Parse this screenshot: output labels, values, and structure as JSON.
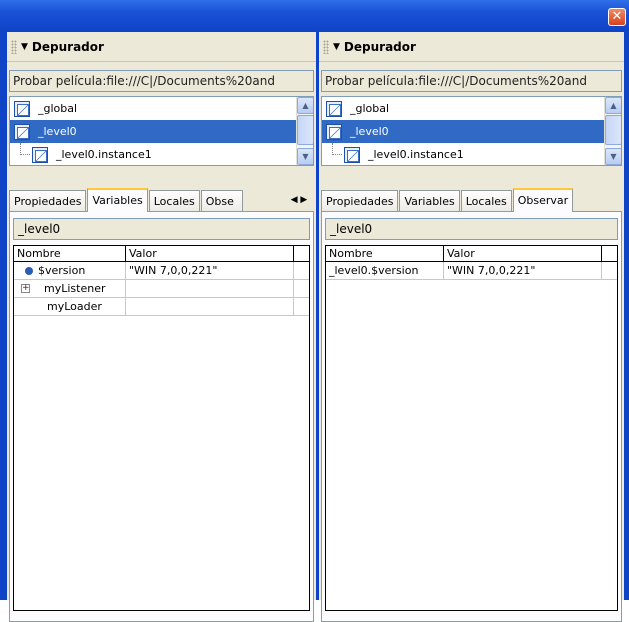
{
  "window": {
    "close_glyph": "✕"
  },
  "panels": [
    {
      "title": "Depurador",
      "url": "Probar película:file:///C|/Documents%20and",
      "tree": [
        {
          "label": "_global",
          "selected": false
        },
        {
          "label": "_level0",
          "selected": true
        },
        {
          "label": "_level0.instance1",
          "selected": false
        }
      ],
      "tabs": [
        "Propiedades",
        "Variables",
        "Locales",
        "Obse"
      ],
      "active_tab": "Variables",
      "path": "_level0",
      "columns": [
        "Nombre",
        "Valor"
      ],
      "rows": [
        {
          "name": "$version",
          "value": "\"WIN 7,0,0,221\"",
          "marker": "bullet"
        },
        {
          "name": "myListener",
          "value": "",
          "marker": "expand"
        },
        {
          "name": "myLoader",
          "value": "",
          "marker": "none"
        }
      ]
    },
    {
      "title": "Depurador",
      "url": "Probar película:file:///C|/Documents%20and",
      "tree": [
        {
          "label": "_global",
          "selected": false
        },
        {
          "label": "_level0",
          "selected": true
        },
        {
          "label": "_level0.instance1",
          "selected": false
        }
      ],
      "tabs": [
        "Propiedades",
        "Variables",
        "Locales",
        "Observar"
      ],
      "active_tab": "Observar",
      "path": "_level0",
      "columns": [
        "Nombre",
        "Valor"
      ],
      "rows": [
        {
          "name": "_level0.$version",
          "value": "\"WIN 7,0,0,221\"",
          "marker": "none"
        }
      ]
    }
  ],
  "icons": {
    "collapse": "triangle-down-icon",
    "movieclip": "movieclip-icon",
    "scroll_up": "scroll-up-arrow-icon",
    "scroll_down": "scroll-down-arrow-icon",
    "tab_scroll": "tab-scroll-arrows-icon",
    "bullet": "variable-bullet-icon",
    "expand": "expand-plus-icon"
  },
  "colors": {
    "title_bar": "#1a52d6",
    "selection": "#316ac5",
    "panel_bg": "#ece9d8",
    "active_tab_accent": "#ffc83c"
  }
}
